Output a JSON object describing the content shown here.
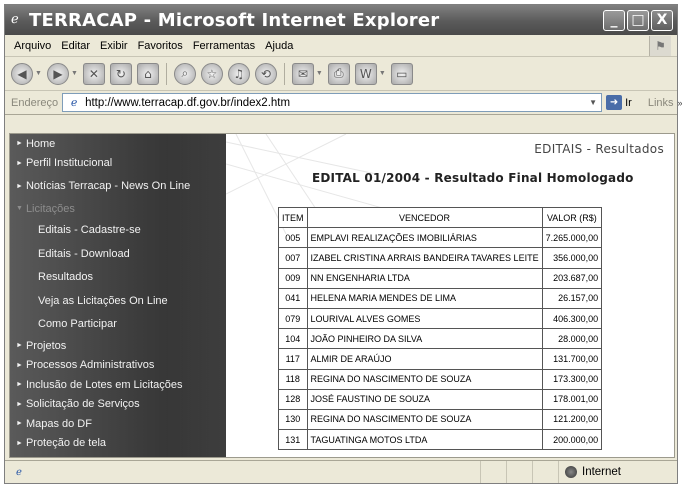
{
  "window": {
    "title": "TERRACAP - Microsoft Internet Explorer",
    "controls": [
      "_",
      "□",
      "X"
    ]
  },
  "menu": [
    "Arquivo",
    "Editar",
    "Exibir",
    "Favoritos",
    "Ferramentas",
    "Ajuda"
  ],
  "address": {
    "label": "Endereço",
    "url": "http://www.terracap.df.gov.br/index2.htm",
    "go_label": "Ir",
    "links_label": "Links",
    "links_chevron": "»"
  },
  "nav": {
    "items": [
      {
        "label": "Home",
        "arrow": "►"
      },
      {
        "label": "Perfil Institucional",
        "arrow": "►"
      },
      {
        "label": "Notícias Terracap - News On Line",
        "arrow": "►"
      },
      {
        "label": "Licitações",
        "arrow": "▼"
      },
      {
        "label": "Editais - Cadastre-se"
      },
      {
        "label": "Editais - Download"
      },
      {
        "label": "Resultados"
      },
      {
        "label": "Veja as Licitações On Line"
      },
      {
        "label": "Como Participar"
      },
      {
        "label": "Projetos",
        "arrow": "►"
      },
      {
        "label": "Processos Administrativos",
        "arrow": "►"
      },
      {
        "label": "Inclusão de Lotes em Licitações",
        "arrow": "►"
      },
      {
        "label": "Solicitação de Serviços",
        "arrow": "►"
      },
      {
        "label": "Mapas do DF",
        "arrow": "►"
      },
      {
        "label": "Proteção de tela",
        "arrow": "►"
      }
    ]
  },
  "main": {
    "section_title": "EDITAIS - Resultados",
    "edital_title": "EDITAL 01/2004 - Resultado Final Homologado",
    "table": {
      "headers": [
        "ITEM",
        "VENCEDOR",
        "VALOR (R$)"
      ],
      "rows": [
        {
          "item": "005",
          "vencedor": "EMPLAVI REALIZAÇÕES IMOBILIÁRIAS",
          "valor": "7.265.000,00"
        },
        {
          "item": "007",
          "vencedor": "IZABEL CRISTINA ARRAIS BANDEIRA TAVARES LEITE",
          "valor": "356.000,00"
        },
        {
          "item": "009",
          "vencedor": "NN ENGENHARIA LTDA",
          "valor": "203.687,00"
        },
        {
          "item": "041",
          "vencedor": "HELENA MARIA MENDES DE LIMA",
          "valor": "26.157,00"
        },
        {
          "item": "079",
          "vencedor": "LOURIVAL ALVES GOMES",
          "valor": "406.300,00"
        },
        {
          "item": "104",
          "vencedor": "JOÃO PINHEIRO DA SILVA",
          "valor": "28.000,00"
        },
        {
          "item": "117",
          "vencedor": "ALMIR DE ARAÚJO",
          "valor": "131.700,00"
        },
        {
          "item": "118",
          "vencedor": "REGINA DO NASCIMENTO DE SOUZA",
          "valor": "173.300,00"
        },
        {
          "item": "128",
          "vencedor": "JOSÉ FAUSTINO DE SOUZA",
          "valor": "178.001,00"
        },
        {
          "item": "130",
          "vencedor": "REGINA DO NASCIMENTO DE SOUZA",
          "valor": "121.200,00"
        },
        {
          "item": "131",
          "vencedor": "TAGUATINGA MOTOS LTDA",
          "valor": "200.000,00"
        }
      ]
    }
  },
  "status": {
    "zone": "Internet"
  },
  "colors": {
    "titlebar": "#5a5a5a",
    "nav_bg": "#3c3c3c",
    "nav_text": "#f2f2f2"
  }
}
